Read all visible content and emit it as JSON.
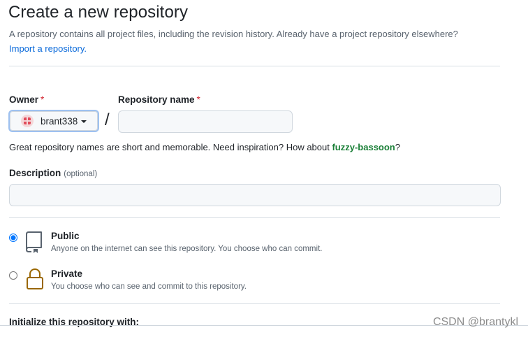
{
  "header": {
    "title": "Create a new repository",
    "subtitle": "A repository contains all project files, including the revision history. Already have a project repository elsewhere?",
    "import_link": "Import a repository."
  },
  "owner": {
    "label": "Owner",
    "required_mark": "*",
    "selected": "brant338"
  },
  "repo_name": {
    "label": "Repository name",
    "required_mark": "*",
    "value": ""
  },
  "separator": "/",
  "name_hint": {
    "text": "Great repository names are short and memorable. Need inspiration? How about ",
    "suggestion": "fuzzy-bassoon",
    "end": "?"
  },
  "description": {
    "label": "Description",
    "optional": "(optional)",
    "value": ""
  },
  "visibility": {
    "selected": "public",
    "public": {
      "title": "Public",
      "desc": "Anyone on the internet can see this repository. You choose who can commit."
    },
    "private": {
      "title": "Private",
      "desc": "You choose who can see and commit to this repository."
    }
  },
  "initialize": {
    "label": "Initialize this repository with:"
  },
  "watermark": "CSDN @brantykl",
  "colors": {
    "link": "#0969da",
    "suggestion": "#1a7f37",
    "required": "#d1242f",
    "lock": "#9a6700"
  }
}
